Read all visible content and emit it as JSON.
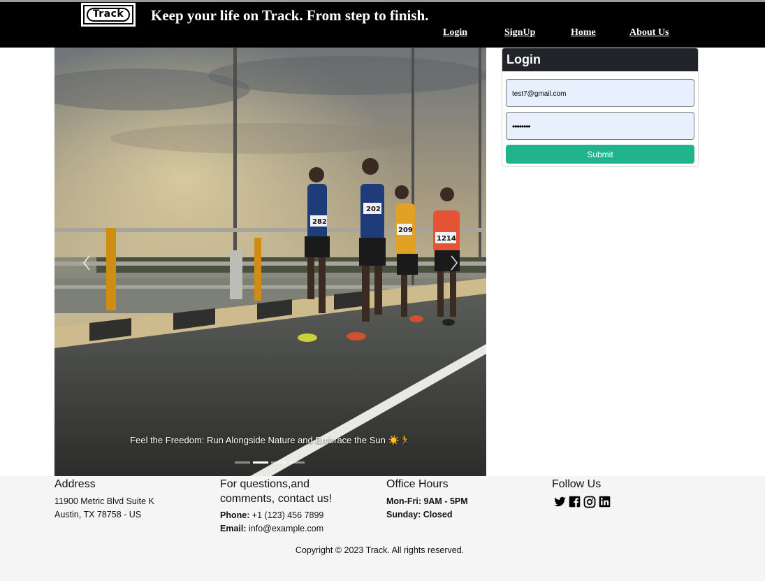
{
  "header": {
    "logo_text": "Track",
    "tagline": "Keep your life on Track. From step to finish.",
    "nav": [
      "Login",
      "SignUp",
      "Home",
      "About Us"
    ]
  },
  "carousel": {
    "caption": "Feel the Freedom: Run Alongside Nature and Embrace the Sun ☀️🏃",
    "prev_icon": "chevron-left-icon",
    "next_icon": "chevron-right-icon",
    "slide_count": 4,
    "active_slide": 2,
    "bibs": [
      "282",
      "202",
      "209",
      "1214"
    ]
  },
  "login": {
    "title": "Login",
    "email_value": "test7@gmail.com",
    "password_mask": "••••••••",
    "submit_label": "Submit"
  },
  "footer": {
    "address": {
      "heading": "Address",
      "line1": "11900 Metric Blvd Suite K",
      "line2": "Austin, TX 78758 - US"
    },
    "contact": {
      "heading": "For questions,and comments, contact us!",
      "phone_label": "Phone:",
      "phone": " +1 (123) 456 7899",
      "email_label": "Email:",
      "email": " info@example.com"
    },
    "hours": {
      "heading": "Office Hours",
      "weekdays": "Mon-Fri: 9AM - 5PM",
      "sunday": "Sunday: Closed"
    },
    "follow": {
      "heading": "Follow Us",
      "icons": [
        "twitter-icon",
        "facebook-icon",
        "instagram-icon",
        "linkedin-icon"
      ]
    },
    "copyright": "Copyright © 2023 Track. All rights reserved."
  },
  "colors": {
    "header_bg": "#000000",
    "submit_bg": "#20b48e",
    "card_header_bg": "#212529",
    "input_bg": "#e8f0fe",
    "footer_bg": "#f5f5f5"
  }
}
